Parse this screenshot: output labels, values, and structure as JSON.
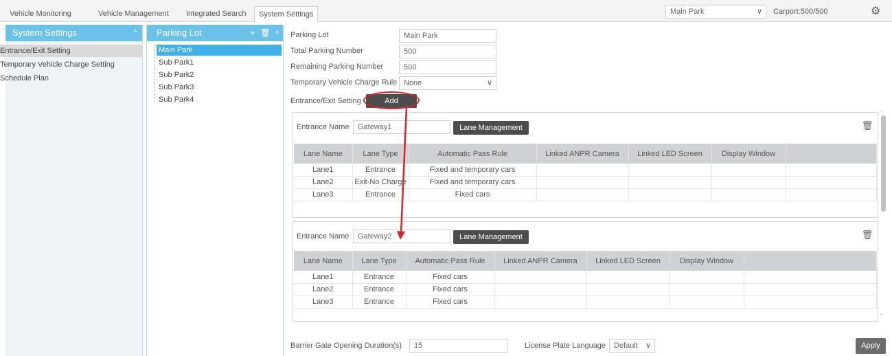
{
  "tabs": [
    {
      "label": "Vehicle Monitoring"
    },
    {
      "label": "Vehicle Management"
    },
    {
      "label": "Integrated Search"
    },
    {
      "label": "System Settings"
    }
  ],
  "park_select": {
    "value": "Main Park"
  },
  "carport": "Carport:500/500",
  "icons": {
    "settings": "gear-icon",
    "dropdown": "chevron-down-icon",
    "add": "plus-icon",
    "delete": "trash-icon",
    "collapse": "caret-up-icon"
  },
  "left_panel": {
    "title": "System Settings",
    "items": [
      {
        "label": "Entrance/Exit Setting"
      },
      {
        "label": "Temporary Vehicle Charge Setting"
      },
      {
        "label": "Schedule Plan"
      }
    ]
  },
  "parking_panel": {
    "title": "Parking Lot",
    "items": [
      {
        "label": "Main Park"
      },
      {
        "label": "Sub Park1"
      },
      {
        "label": "Sub Park2"
      },
      {
        "label": "Sub Park3"
      },
      {
        "label": "Sub Park4"
      }
    ]
  },
  "form": {
    "parking_lot_label": "Parking Lot",
    "parking_lot_value": "Main Park",
    "total_label": "Total Parking Number",
    "total_value": "500",
    "remaining_label": "Remaining Parking Number",
    "remaining_value": "500",
    "charge_rule_label": "Temporary Vehicle Charge Rule",
    "charge_rule_value": "None",
    "entrance_exit_label": "Entrance/Exit Setting",
    "add_label": "Add"
  },
  "gateways": [
    {
      "name_label": "Entrance Name",
      "name_value": "Gateway1",
      "lane_mgmt_label": "Lane Management",
      "columns": [
        "Lane Name",
        "Lane Type",
        "Automatic Pass Rule",
        "Linked ANPR Camera",
        "Linked LED Screen",
        "Display Window",
        ""
      ],
      "rows": [
        [
          "Lane1",
          "Entrance",
          "Fixed and temporary cars",
          "",
          "",
          "",
          ""
        ],
        [
          "Lane2",
          "Exit-No Charge",
          "Fixed and temporary cars",
          "",
          "",
          "",
          ""
        ],
        [
          "Lane3",
          "Entrance",
          "Fixed cars",
          "",
          "",
          "",
          ""
        ]
      ]
    },
    {
      "name_label": "Entrance Name",
      "name_value": "Gateway2",
      "lane_mgmt_label": "Lane Management",
      "columns": [
        "Lane Name",
        "Lane Type",
        "Automatic Pass Rule",
        "Linked ANPR Camera",
        "Linked LED Screen",
        "Display Window",
        ""
      ],
      "rows": [
        [
          "Lane1",
          "Entrance",
          "Fixed cars",
          "",
          "",
          "",
          ""
        ],
        [
          "Lane2",
          "Entrance",
          "Fixed cars",
          "",
          "",
          "",
          ""
        ],
        [
          "Lane3",
          "Entrance",
          "Fixed cars",
          "",
          "",
          "",
          ""
        ]
      ]
    }
  ],
  "footer": {
    "barrier_label": "Barrier Gate Opening Duration(s)",
    "barrier_value": "15",
    "language_label": "License Plate Language",
    "language_value": "Default",
    "apply_label": "Apply"
  },
  "colors": {
    "accent": "#6cc1e9",
    "selected": "#3fb1e8",
    "annotation": "#d8232a",
    "button": "#4d4d4d"
  }
}
